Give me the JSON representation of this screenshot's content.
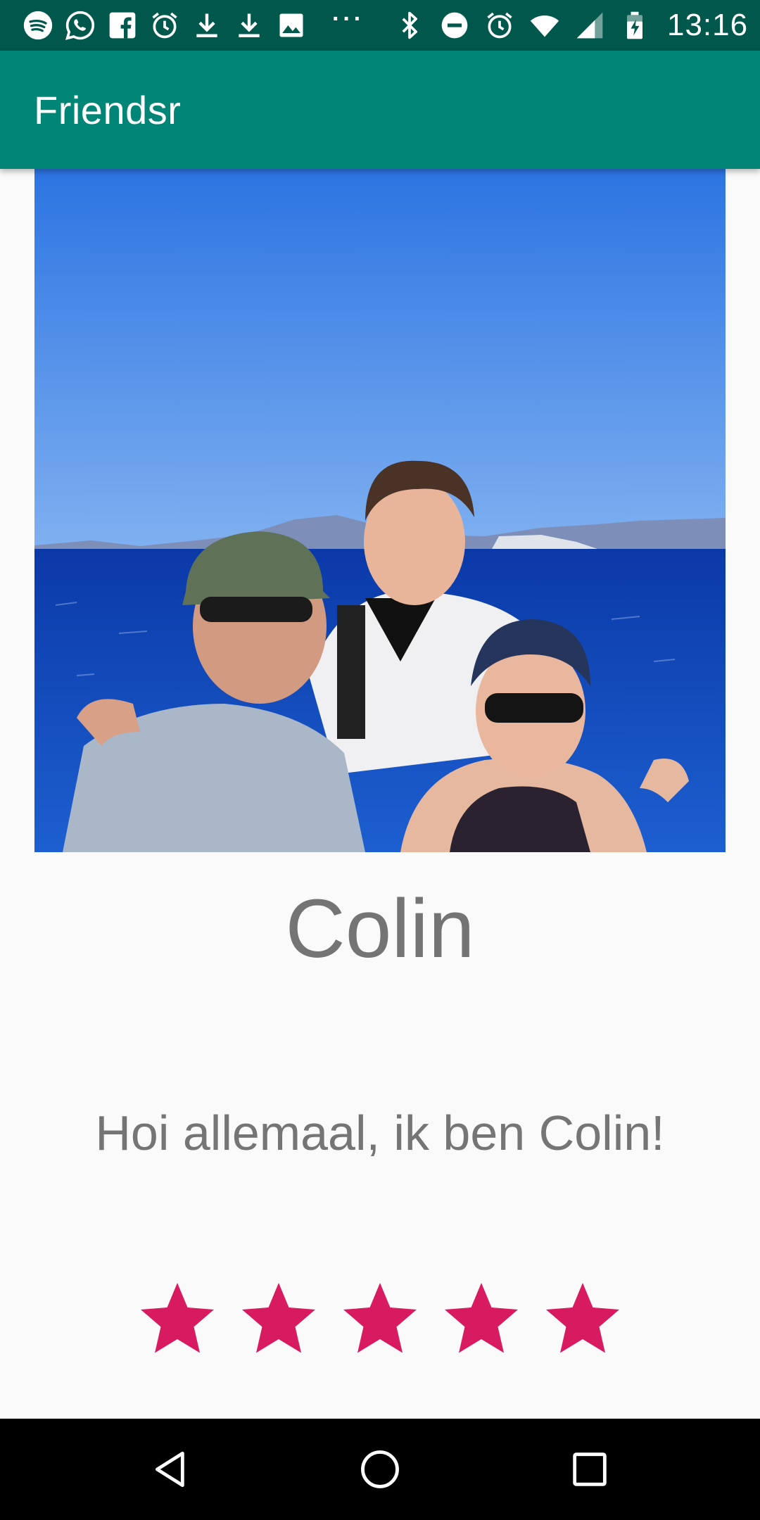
{
  "status_bar": {
    "time": "13:16",
    "left_icons": [
      "spotify-icon",
      "whatsapp-icon",
      "facebook-icon",
      "alarm-icon",
      "download-icon",
      "download-icon",
      "image-icon"
    ],
    "overflow": "···",
    "right_icons": [
      "bluetooth-icon",
      "do-not-disturb-icon",
      "alarm-icon",
      "wifi-icon",
      "signal-icon",
      "battery-charging-icon"
    ]
  },
  "app_bar": {
    "title": "Friendsr"
  },
  "profile": {
    "photo_icon": "profile-photo",
    "name": "Colin",
    "bio": "Hoi allemaal, ik ben Colin!"
  },
  "rating": {
    "value": 5,
    "max": 5
  },
  "nav_bar": {
    "buttons": [
      "back-icon",
      "home-icon",
      "recents-icon"
    ]
  },
  "colors": {
    "status_bar": "#00574b",
    "app_bar": "#008577",
    "star": "#d81b60",
    "text": "#757575",
    "background": "#fafafa"
  }
}
